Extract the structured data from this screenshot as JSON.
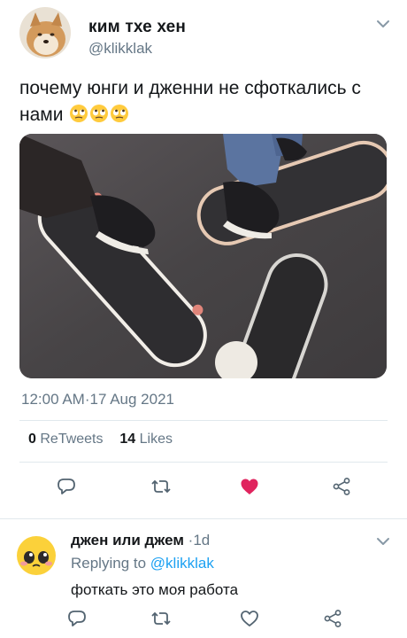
{
  "tweet": {
    "author_name": "ким тхе хен",
    "author_handle": "@klikklak",
    "text": "почему юнги и дженни не сфоткались с нами",
    "emojis": [
      "face-with-rolling-eyes",
      "face-with-rolling-eyes",
      "face-with-rolling-eyes"
    ],
    "time": "12:00 AM",
    "date": "17 Aug 2021",
    "retweets_count": "0",
    "retweets_label": "ReTweets",
    "likes_count": "14",
    "likes_label": "Likes",
    "liked": true
  },
  "reply": {
    "author_name": "джен или джем",
    "time_ago": "1d",
    "replying_label": "Replying to",
    "replying_handle": "@klikklak",
    "text": "фоткать это моя работа"
  },
  "colors": {
    "text": "#14171a",
    "muted": "#657786",
    "accent": "#1da1f2",
    "like": "#e0245e",
    "separator": "#e1e8ed"
  },
  "icons": {
    "reply": "speech-bubble",
    "retweet": "retweet-arrows",
    "like": "heart",
    "share": "share-nodes",
    "menu": "chevron-down"
  }
}
